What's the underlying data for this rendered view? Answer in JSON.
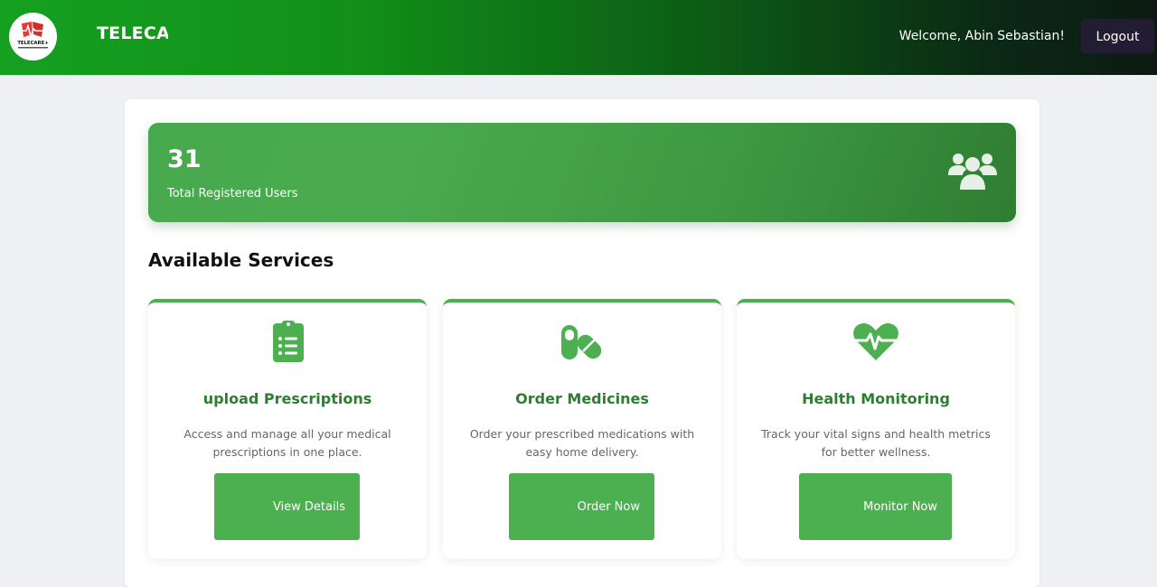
{
  "header": {
    "brand": "TELECARE+",
    "logo_text": "TELECARE+",
    "welcome": "Welcome, Abin Sebastian!",
    "logout_label": "Logout"
  },
  "stats": {
    "total_users": "31",
    "total_users_label": "Total Registered Users",
    "icon": "users-icon"
  },
  "services": {
    "title": "Available Services",
    "items": [
      {
        "icon": "clipboard-list-icon",
        "title": "upload Prescriptions",
        "description": "Access and manage all your medical prescriptions in one place.",
        "button": "View Details"
      },
      {
        "icon": "pills-icon",
        "title": "Order Medicines",
        "description": "Order your prescribed medications with easy home delivery.",
        "button": "Order Now"
      },
      {
        "icon": "heartbeat-icon",
        "title": "Health Monitoring",
        "description": "Track your vital signs and health metrics for better wellness.",
        "button": "Monitor Now"
      }
    ]
  },
  "colors": {
    "primary": "#4caf50",
    "primary_dark": "#2e7d32",
    "logout_bg": "#231d33",
    "page_bg": "#eef0f3"
  }
}
